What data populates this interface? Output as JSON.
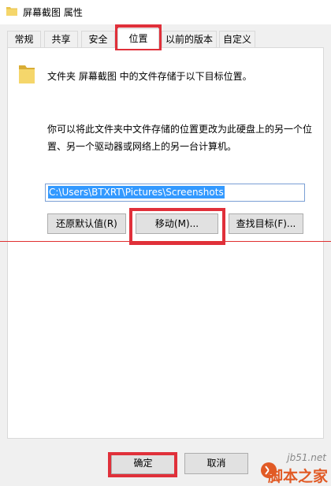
{
  "window": {
    "title": "屏幕截图 属性"
  },
  "tabs": [
    {
      "label": "常规"
    },
    {
      "label": "共享"
    },
    {
      "label": "安全"
    },
    {
      "label": "位置",
      "active": true
    },
    {
      "label": "以前的版本"
    },
    {
      "label": "自定义"
    }
  ],
  "location": {
    "description": "文件夹 屏幕截图 中的文件存储于以下目标位置。",
    "help_text": "你可以将此文件夹中文件存储的位置更改为此硬盘上的另一个位置、另一个驱动器或网络上的另一台计算机。",
    "path_value": "C:\\Users\\BTXRT\\Pictures\\Screenshots",
    "restore_label": "还原默认值(R)",
    "move_label": "移动(M)...",
    "find_label": "查找目标(F)..."
  },
  "footer": {
    "ok_label": "确定",
    "cancel_label": "取消"
  },
  "watermark": {
    "site": "jb51.net",
    "name": "脚本之家"
  },
  "colors": {
    "highlight": "#e0303a",
    "folder": "#e8c24a",
    "selection": "#3399ff",
    "watermark": "#e15a25"
  }
}
